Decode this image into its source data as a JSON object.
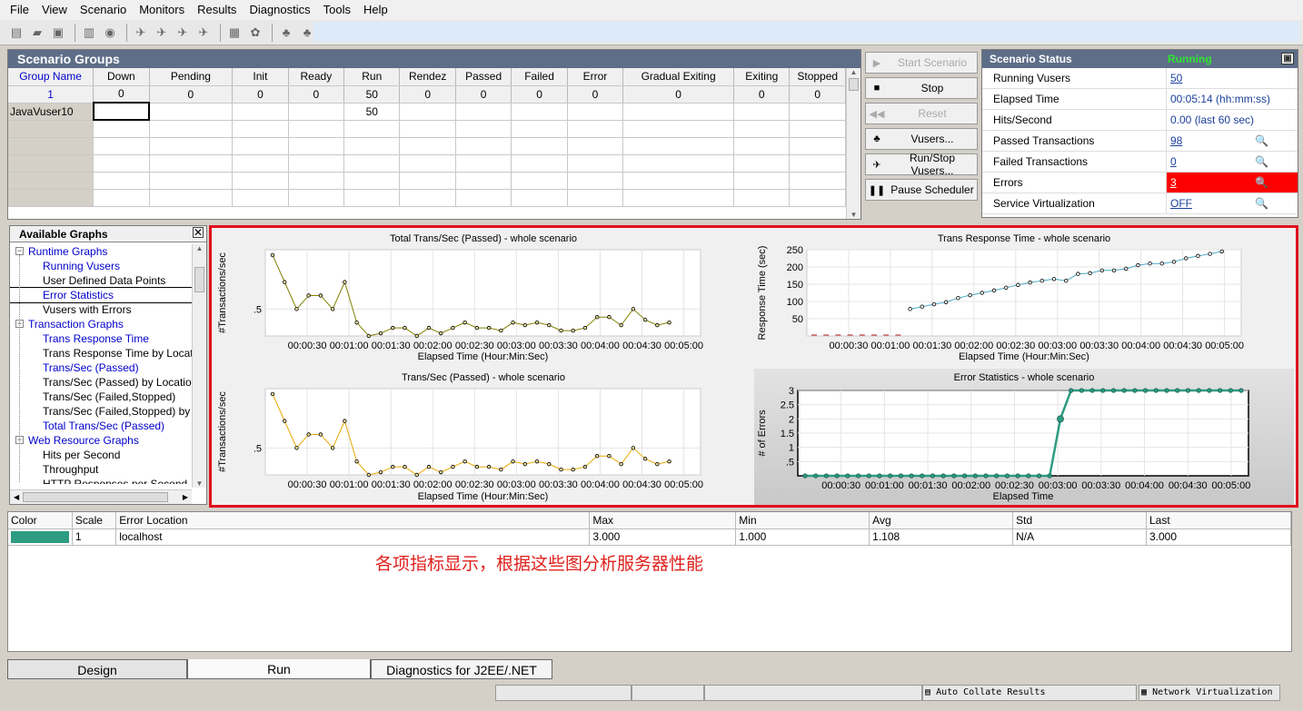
{
  "menu": [
    "File",
    "View",
    "Scenario",
    "Monitors",
    "Results",
    "Diagnostics",
    "Tools",
    "Help"
  ],
  "scenario_groups": {
    "title": "Scenario Groups",
    "headers": [
      "Group Name",
      "Down",
      "Pending",
      "Init",
      "Ready",
      "Run",
      "Rendez",
      "Passed",
      "Failed",
      "Error",
      "Gradual Exiting",
      "Exiting",
      "Stopped"
    ],
    "totals": [
      "1",
      "0",
      "0",
      "0",
      "0",
      "50",
      "0",
      "0",
      "0",
      "0",
      "0",
      "0",
      "0"
    ],
    "row": [
      "JavaVuser10",
      "",
      "",
      "",
      "",
      "50",
      "",
      "",
      "",
      "",
      "",
      "",
      ""
    ]
  },
  "buttons": {
    "start": "Start Scenario",
    "stop": "Stop",
    "reset": "Reset",
    "vusers": "Vusers...",
    "runstop": "Run/Stop Vusers...",
    "pause": "Pause Scheduler"
  },
  "status": {
    "title": "Scenario Status",
    "state": "Running",
    "rows": [
      {
        "k": "Running Vusers",
        "v": "50"
      },
      {
        "k": "Elapsed Time",
        "v": "00:05:14 (hh:mm:ss)"
      },
      {
        "k": "Hits/Second",
        "v": "0.00 (last 60 sec)"
      },
      {
        "k": "Passed Transactions",
        "v": "98"
      },
      {
        "k": "Failed Transactions",
        "v": "0"
      },
      {
        "k": "Errors",
        "v": "3"
      },
      {
        "k": "Service Virtualization",
        "v": "OFF"
      }
    ]
  },
  "avail": {
    "title": "Available Graphs",
    "items": [
      {
        "t": "Runtime Graphs",
        "c": 1
      },
      {
        "t": "Running Vusers",
        "b": 1
      },
      {
        "t": "User Defined Data Points"
      },
      {
        "t": "Error Statistics",
        "b": 1,
        "s": 1
      },
      {
        "t": "Vusers with Errors"
      },
      {
        "t": "Transaction Graphs",
        "c": 1
      },
      {
        "t": "Trans Response Time",
        "b": 1
      },
      {
        "t": "Trans Response Time by Location"
      },
      {
        "t": "Trans/Sec (Passed)",
        "b": 1
      },
      {
        "t": "Trans/Sec (Passed) by Location"
      },
      {
        "t": "Trans/Sec (Failed,Stopped)"
      },
      {
        "t": "Trans/Sec (Failed,Stopped) by Location"
      },
      {
        "t": "Total Trans/Sec (Passed)",
        "b": 1
      },
      {
        "t": "Web Resource Graphs",
        "c": 1
      },
      {
        "t": "Hits per Second"
      },
      {
        "t": "Throughput"
      },
      {
        "t": "HTTP Responses per Second"
      }
    ]
  },
  "chart_data": [
    {
      "type": "line",
      "title": "Total Trans/Sec (Passed) - whole scenario",
      "xlabel": "Elapsed Time (Hour:Min:Sec)",
      "ylabel": "#Transactions/sec",
      "yticks": [
        ".5"
      ],
      "ylim": [
        0,
        1.6
      ],
      "xticks": [
        "00:00:30",
        "00:01:00",
        "00:01:30",
        "00:02:00",
        "00:02:30",
        "00:03:00",
        "00:03:30",
        "00:04:00",
        "00:04:30",
        "00:05:00"
      ],
      "series": [
        {
          "color": "#808000",
          "values": [
            1.5,
            1.0,
            0.5,
            0.75,
            0.75,
            0.5,
            1.0,
            0.25,
            0,
            0.05,
            0.15,
            0.15,
            0,
            0.15,
            0.05,
            0.15,
            0.25,
            0.15,
            0.15,
            0.1,
            0.25,
            0.2,
            0.25,
            0.2,
            0.1,
            0.1,
            0.15,
            0.35,
            0.35,
            0.2,
            0.5,
            0.3,
            0.2,
            0.25
          ]
        }
      ]
    },
    {
      "type": "line",
      "title": "Trans Response Time - whole scenario",
      "xlabel": "Elapsed Time (Hour:Min:Sec)",
      "ylabel": "Response Time (sec)",
      "yticks": [
        "250",
        "200",
        "150",
        "100",
        "50"
      ],
      "ylim": [
        0,
        250
      ],
      "xticks": [
        "00:00:30",
        "00:01:00",
        "00:01:30",
        "00:02:00",
        "00:02:30",
        "00:03:00",
        "00:03:30",
        "00:04:00",
        "00:04:30",
        "00:05:00"
      ],
      "series": [
        {
          "color": "#4aa8c8",
          "values": [
            0,
            0,
            0,
            0,
            0,
            0,
            0,
            0,
            78,
            85,
            92,
            98,
            110,
            118,
            125,
            132,
            140,
            148,
            155,
            160,
            165,
            160,
            180,
            182,
            190,
            190,
            195,
            205,
            210,
            210,
            215,
            225,
            232,
            238,
            245
          ]
        }
      ]
    },
    {
      "type": "line",
      "title": "Trans/Sec (Passed) - whole scenario",
      "xlabel": "Elapsed Time (Hour:Min:Sec)",
      "ylabel": "#Transactions/sec",
      "yticks": [
        ".5"
      ],
      "ylim": [
        0,
        1.6
      ],
      "xticks": [
        "00:00:30",
        "00:01:00",
        "00:01:30",
        "00:02:00",
        "00:02:30",
        "00:03:00",
        "00:03:30",
        "00:04:00",
        "00:04:30",
        "00:05:00"
      ],
      "series": [
        {
          "color": "#e8a800",
          "values": [
            1.5,
            1.0,
            0.5,
            0.75,
            0.75,
            0.5,
            1.0,
            0.25,
            0,
            0.05,
            0.15,
            0.15,
            0,
            0.15,
            0.05,
            0.15,
            0.25,
            0.15,
            0.15,
            0.1,
            0.25,
            0.2,
            0.25,
            0.2,
            0.1,
            0.1,
            0.15,
            0.35,
            0.35,
            0.2,
            0.5,
            0.3,
            0.2,
            0.25
          ]
        }
      ]
    },
    {
      "type": "line",
      "title": "Error Statistics - whole scenario",
      "xlabel": "Elapsed Time",
      "ylabel": "# of Errors",
      "yticks": [
        "3",
        "2.5",
        "2",
        "1.5",
        "1",
        ".5"
      ],
      "ylim": [
        0,
        3
      ],
      "xticks": [
        "00:00:30",
        "00:01:00",
        "00:01:30",
        "00:02:00",
        "00:02:30",
        "00:03:00",
        "00:03:30",
        "00:04:00",
        "00:04:30",
        "00:05:00"
      ],
      "series": [
        {
          "color": "#2e9c82",
          "values": [
            0,
            0,
            0,
            0,
            0,
            0,
            0,
            0,
            0,
            0,
            0,
            0,
            0,
            0,
            0,
            0,
            0,
            0,
            0,
            0,
            0,
            0,
            0,
            0,
            2,
            3,
            3,
            3,
            3,
            3,
            3,
            3,
            3,
            3,
            3,
            3,
            3,
            3,
            3,
            3,
            3,
            3
          ]
        }
      ]
    }
  ],
  "errtable": {
    "headers": [
      "Color",
      "Scale",
      "Error Location",
      "Max",
      "Min",
      "Avg",
      "Std",
      "Last"
    ],
    "row": [
      "",
      "1",
      "localhost",
      "3.000",
      "1.000",
      "1.108",
      "N/A",
      "3.000"
    ],
    "swatch": "#2e9c82"
  },
  "note": "各项指标显示，根据这些图分析服务器性能",
  "tabs": [
    "Design",
    "Run",
    "Diagnostics for J2EE/.NET"
  ],
  "statusbar": {
    "collate": "Auto Collate Results",
    "netvirt": "Network Virtualization"
  }
}
